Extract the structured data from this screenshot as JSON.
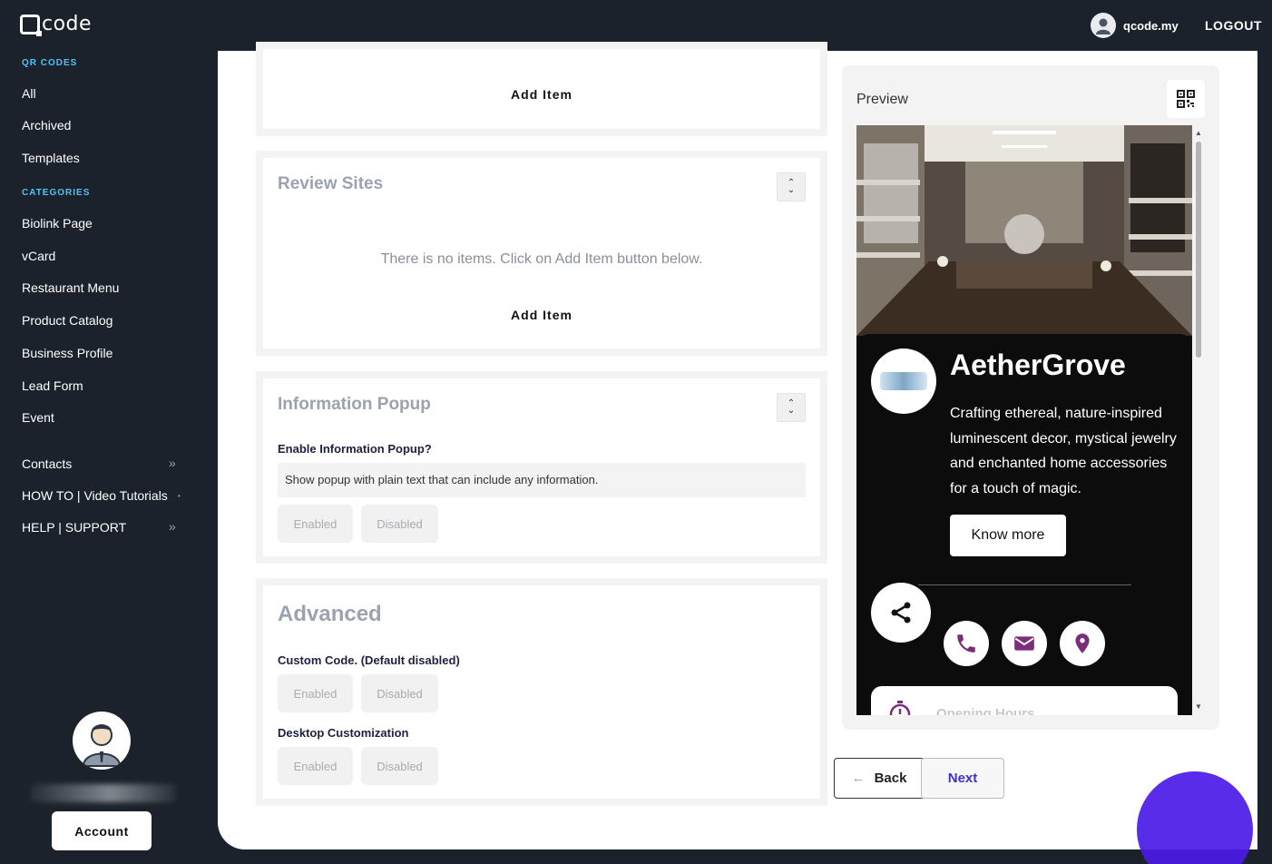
{
  "app": {
    "logo_text": "code",
    "user_name": "qcode.my",
    "logout_label": "LOGOUT"
  },
  "sidebar": {
    "qr_section_label": "QR CODES",
    "qr_items": [
      {
        "label": "All"
      },
      {
        "label": "Archived"
      },
      {
        "label": "Templates"
      }
    ],
    "categories_label": "CATEGORIES",
    "category_items": [
      {
        "label": "Biolink Page"
      },
      {
        "label": "vCard"
      },
      {
        "label": "Restaurant Menu"
      },
      {
        "label": "Product Catalog"
      },
      {
        "label": "Business Profile"
      },
      {
        "label": "Lead Form"
      },
      {
        "label": "Event"
      }
    ],
    "extra_items": [
      {
        "label": "Contacts"
      },
      {
        "label": "HOW TO | Video Tutorials"
      },
      {
        "label": "HELP | SUPPORT"
      }
    ],
    "account_label": "Account"
  },
  "editor": {
    "top_card": {
      "add_item_label": "Add Item"
    },
    "review_sites": {
      "title": "Review Sites",
      "empty_message": "There is no items. Click on Add Item button below.",
      "add_item_label": "Add Item"
    },
    "info_popup": {
      "title": "Information Popup",
      "field_label": "Enable Information Popup?",
      "help_text": "Show popup with plain text that can include any information.",
      "enabled_label": "Enabled",
      "disabled_label": "Disabled"
    },
    "advanced": {
      "title": "Advanced",
      "custom_code_label": "Custom Code. (Default disabled)",
      "desktop_label": "Desktop Customization",
      "enabled_label": "Enabled",
      "disabled_label": "Disabled"
    }
  },
  "preview": {
    "title": "Preview",
    "business_name": "AetherGrove",
    "description": "Crafting ethereal, nature-inspired luminescent decor, mystical jewelry and enchanted home accessories for a touch of magic.",
    "know_more_label": "Know more",
    "hours_label": "Opening Hours",
    "accent_color": "#7b2d7b"
  },
  "actions": {
    "back_label": "Back",
    "next_label": "Next"
  }
}
